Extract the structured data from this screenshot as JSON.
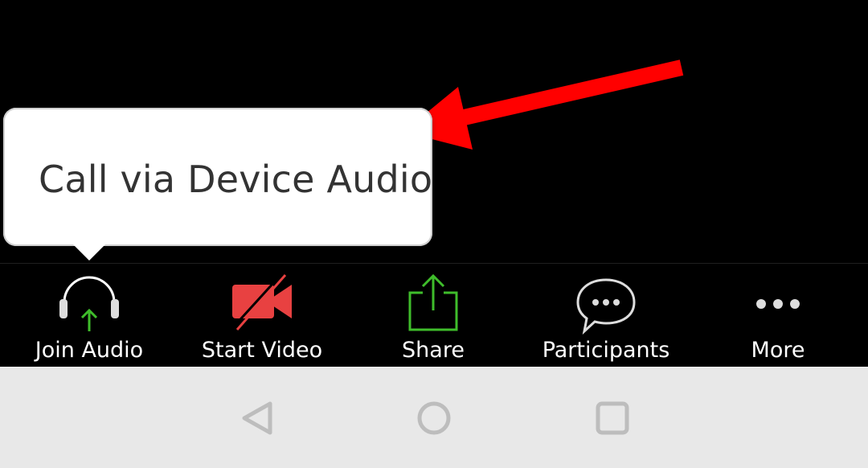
{
  "tooltip": {
    "text": "Call via Device Audio"
  },
  "toolbar": {
    "items": [
      {
        "label": "Join Audio",
        "icon": "headphones-icon"
      },
      {
        "label": "Start Video",
        "icon": "video-off-icon"
      },
      {
        "label": "Share",
        "icon": "share-icon"
      },
      {
        "label": "Participants",
        "icon": "chat-bubble-icon"
      },
      {
        "label": "More",
        "icon": "more-dots-icon"
      }
    ]
  },
  "colors": {
    "accent_green": "#3fbd2b",
    "video_red": "#e84141",
    "arrow_red": "#ff0000",
    "navbar_bg": "#e8e8e8"
  },
  "navbar": {
    "buttons": [
      "back-icon",
      "home-icon",
      "recents-icon"
    ]
  }
}
